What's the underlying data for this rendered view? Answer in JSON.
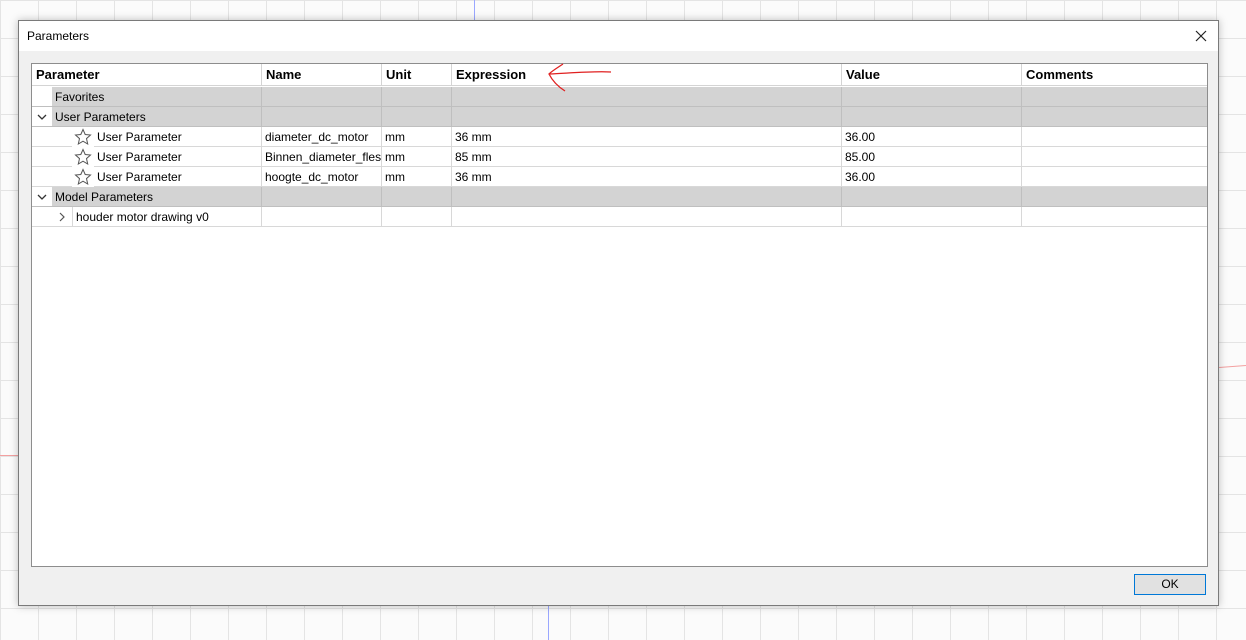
{
  "window": {
    "title": "Parameters",
    "close_icon": "close-icon"
  },
  "table": {
    "columns": [
      "Parameter",
      "Name",
      "Unit",
      "Expression",
      "Value",
      "Comments"
    ],
    "groups": {
      "favorites": {
        "label": "Favorites"
      },
      "user_parameters": {
        "label": "User Parameters",
        "expanded": true,
        "add_icon": "plus-icon",
        "rows": [
          {
            "parameter": "User Parameter",
            "name": "diameter_dc_motor",
            "unit": "mm",
            "expression": "36 mm",
            "value": "36.00",
            "comments": ""
          },
          {
            "parameter": "User Parameter",
            "name": "Binnen_diameter_fles",
            "unit": "mm",
            "expression": "85 mm",
            "value": "85.00",
            "comments": ""
          },
          {
            "parameter": "User Parameter",
            "name": "hoogte_dc_motor",
            "unit": "mm",
            "expression": "36 mm",
            "value": "36.00",
            "comments": ""
          }
        ]
      },
      "model_parameters": {
        "label": "Model Parameters",
        "expanded": true,
        "rows": [
          {
            "label": "houder motor drawing v0",
            "expanded": false
          }
        ]
      }
    }
  },
  "annotation": {
    "icon": "red-arrow-annotation-icon",
    "color": "#e02020"
  },
  "footer": {
    "ok_label": "OK",
    "accent": "#0078d7"
  }
}
